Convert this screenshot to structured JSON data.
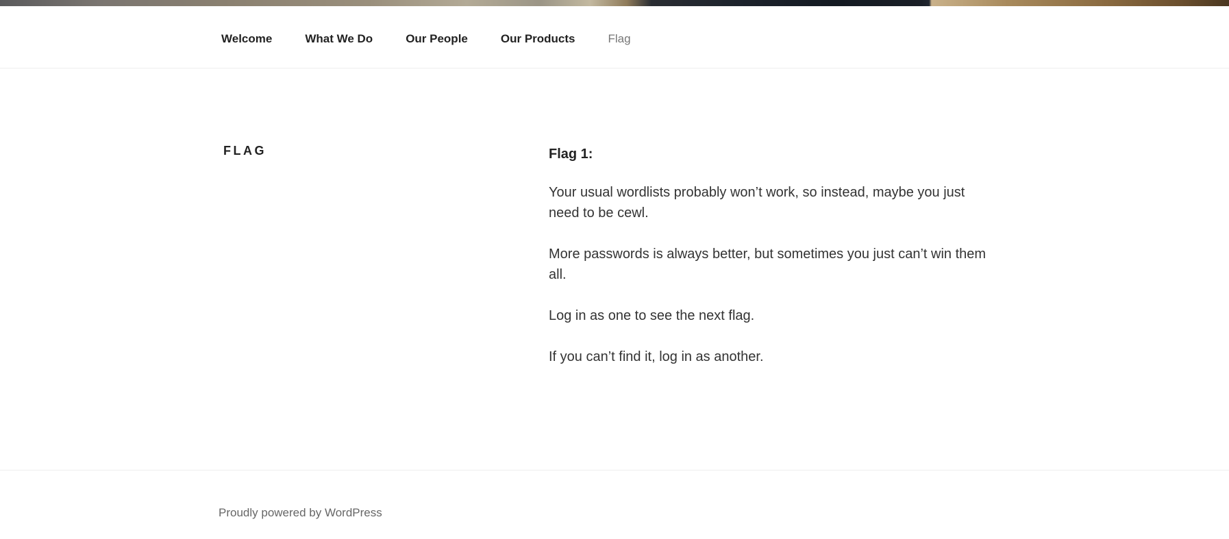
{
  "nav": {
    "items": [
      {
        "label": "Welcome"
      },
      {
        "label": "What We Do"
      },
      {
        "label": "Our People"
      },
      {
        "label": "Our Products"
      },
      {
        "label": "Flag"
      }
    ]
  },
  "page": {
    "title": "Flag"
  },
  "content": {
    "heading": "Flag 1:",
    "paragraphs": [
      "Your usual wordlists probably won’t work, so instead, maybe you just need to be cewl.",
      "More passwords is always better, but sometimes you just can’t win them all.",
      "Log in as one to see the next flag.",
      "If you can’t find it, log in as another."
    ]
  },
  "footer": {
    "credit": "Proudly powered by WordPress"
  }
}
